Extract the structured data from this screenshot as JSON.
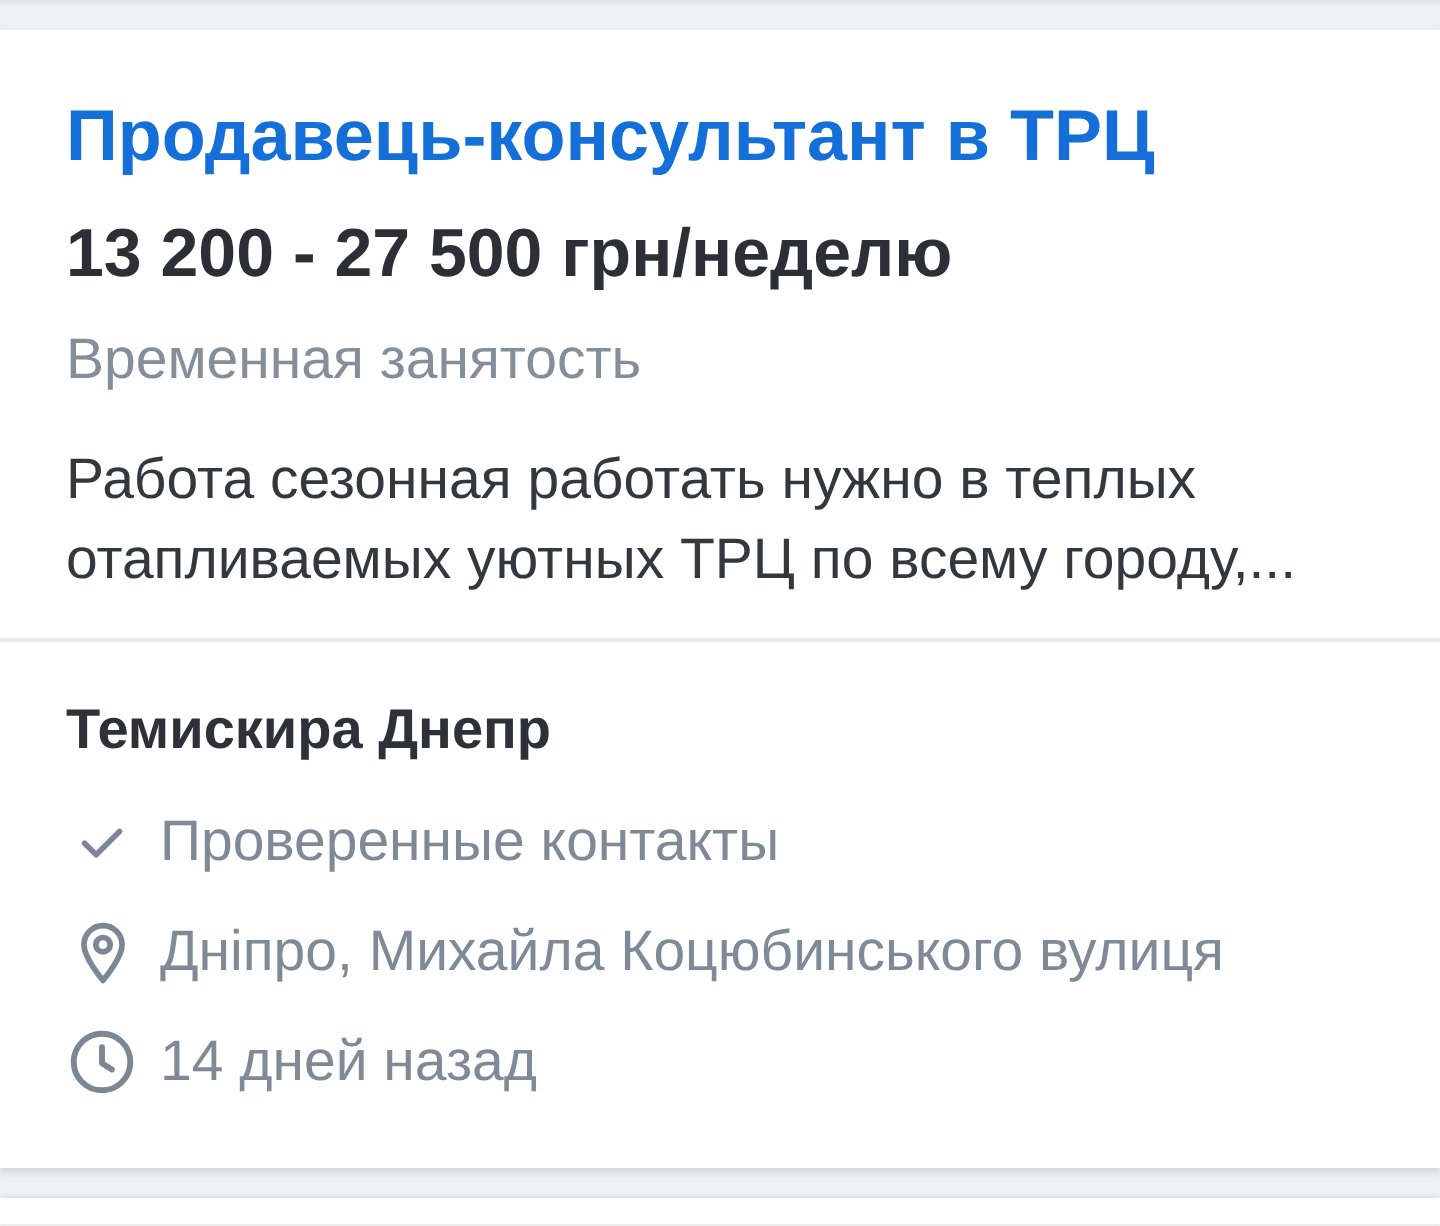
{
  "vacancy": {
    "title": "Продавець-консультант в ТРЦ",
    "salary": "13 200 - 27 500 грн/неделю",
    "employment_type": "Временная занятость",
    "description": "Работа сезонная работать нужно в теплых отапливаемых уютных ТРЦ по всему городу,..."
  },
  "employer": {
    "name": "Темискира Днепр",
    "details": [
      {
        "kind": "verified",
        "text": "Проверенные контакты"
      },
      {
        "kind": "location",
        "text": "Дніпро, Михайла Коцюбинського вулиця"
      },
      {
        "kind": "posted",
        "text": "14 дней назад"
      }
    ]
  }
}
